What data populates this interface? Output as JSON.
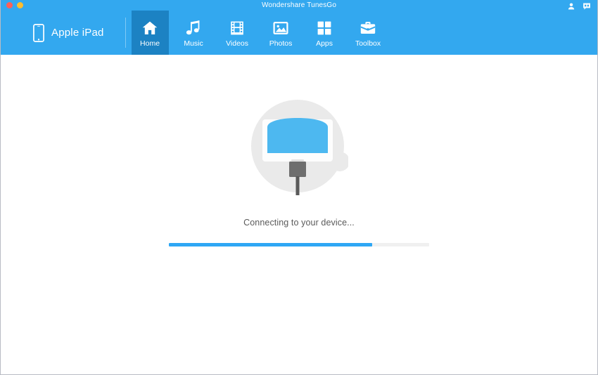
{
  "window": {
    "title": "Wondershare TunesGo",
    "traffic_lights": [
      {
        "name": "close",
        "color": "#ff5f57"
      },
      {
        "name": "minimize",
        "color": "#ffbd2e"
      }
    ],
    "title_actions": [
      {
        "name": "account-icon",
        "label": "Account"
      },
      {
        "name": "feedback-icon",
        "label": "Feedback"
      }
    ]
  },
  "header": {
    "device": {
      "icon": "tablet-icon",
      "name": "Apple iPad"
    },
    "nav": [
      {
        "label": "Home",
        "icon": "home-icon",
        "active": true
      },
      {
        "label": "Music",
        "icon": "music-icon",
        "active": false
      },
      {
        "label": "Videos",
        "icon": "video-icon",
        "active": false
      },
      {
        "label": "Photos",
        "icon": "photo-icon",
        "active": false
      },
      {
        "label": "Apps",
        "icon": "apps-icon",
        "active": false
      },
      {
        "label": "Toolbox",
        "icon": "toolbox-icon",
        "active": false
      }
    ]
  },
  "main": {
    "illustration": "device-connecting-illustration",
    "status_text": "Connecting to your device...",
    "progress_percent": 78
  },
  "colors": {
    "header_blue": "#33a8ef",
    "active_tab_blue": "#1c82c3",
    "progress_blue": "#2ea7f5",
    "progress_track": "#f0f0f0",
    "illustration_circle": "#eaeaea",
    "illustration_screen": "#4db8f0",
    "status_text": "#5a5a5a"
  }
}
